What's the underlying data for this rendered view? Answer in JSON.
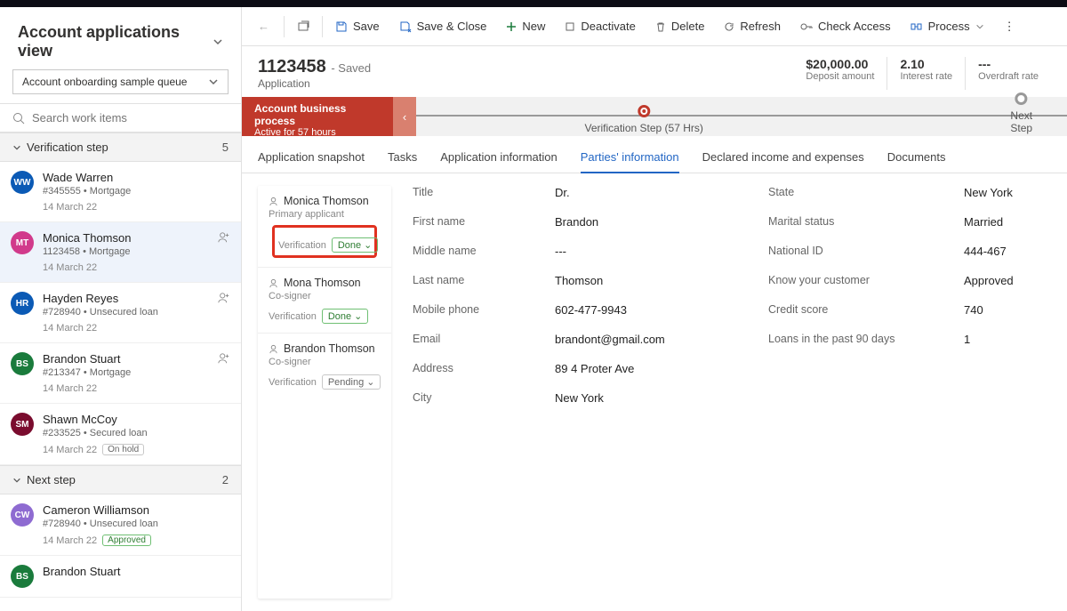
{
  "view_title": "Account applications view",
  "queue_selected": "Account onboarding sample queue",
  "search_placeholder": "Search work items",
  "sections": {
    "verification": {
      "label": "Verification step",
      "count": "5"
    },
    "next": {
      "label": "Next step",
      "count": "2"
    }
  },
  "queue_items": [
    {
      "name": "Wade Warren",
      "sub": "#345555 • Mortgage",
      "date": "14 March 22",
      "initials": "WW"
    },
    {
      "name": "Monica Thomson",
      "sub": "1123458 • Mortgage",
      "date": "14 March 22",
      "initials": "MT"
    },
    {
      "name": "Hayden Reyes",
      "sub": "#728940 • Unsecured loan",
      "date": "14 March 22",
      "initials": "HR"
    },
    {
      "name": "Brandon Stuart",
      "sub": "#213347 • Mortgage",
      "date": "14 March 22",
      "initials": "BS"
    },
    {
      "name": "Shawn McCoy",
      "sub": "#233525 • Secured loan",
      "date": "14 March 22",
      "initials": "SM",
      "hold": "On hold"
    },
    {
      "name": "Cameron Williamson",
      "sub": "#728940 • Unsecured loan",
      "date": "14 March 22",
      "initials": "CW",
      "approved": "Approved"
    },
    {
      "name": "Brandon Stuart",
      "sub": "",
      "date": "",
      "initials": "BS"
    }
  ],
  "toolbar": {
    "save": "Save",
    "save_close": "Save & Close",
    "new": "New",
    "deactivate": "Deactivate",
    "delete": "Delete",
    "refresh": "Refresh",
    "check_access": "Check Access",
    "process": "Process"
  },
  "record": {
    "id": "1123458",
    "status": "Saved",
    "entity": "Application",
    "stats": [
      {
        "val": "$20,000.00",
        "lbl": "Deposit amount"
      },
      {
        "val": "2.10",
        "lbl": "Interest rate"
      },
      {
        "val": "---",
        "lbl": "Overdraft rate"
      }
    ]
  },
  "bpf": {
    "title": "Account business process",
    "subtitle": "Active for 57 hours",
    "current": "Verification Step  (57 Hrs)",
    "next": "Next Step"
  },
  "tabs": [
    "Application snapshot",
    "Tasks",
    "Application information",
    "Parties' information",
    "Declared income and expenses",
    "Documents"
  ],
  "active_tab": 3,
  "parties": [
    {
      "name": "Monica Thomson",
      "role": "Primary applicant",
      "ver_label": "Verification",
      "ver_status": "Done",
      "highlight": true
    },
    {
      "name": "Mona Thomson",
      "role": "Co-signer",
      "ver_label": "Verification",
      "ver_status": "Done"
    },
    {
      "name": "Brandon Thomson",
      "role": "Co-signer",
      "ver_label": "Verification",
      "ver_status": "Pending"
    }
  ],
  "fields_left": [
    {
      "label": "Title",
      "value": "Dr."
    },
    {
      "label": "First name",
      "value": "Brandon"
    },
    {
      "label": "Middle name",
      "value": "---"
    },
    {
      "label": "Last name",
      "value": "Thomson"
    },
    {
      "label": "Mobile phone",
      "value": "602-477-9943"
    },
    {
      "label": "Email",
      "value": "brandont@gmail.com"
    },
    {
      "label": "Address",
      "value": "89 4 Proter Ave"
    },
    {
      "label": "City",
      "value": "New York"
    }
  ],
  "fields_right": [
    {
      "label": "State",
      "value": "New York"
    },
    {
      "label": "Marital status",
      "value": "Married"
    },
    {
      "label": "National ID",
      "value": "444-467"
    },
    {
      "label": "Know your customer",
      "value": "Approved"
    },
    {
      "label": "Credit score",
      "value": "740"
    },
    {
      "label": "Loans in the past 90 days",
      "value": "1"
    }
  ]
}
